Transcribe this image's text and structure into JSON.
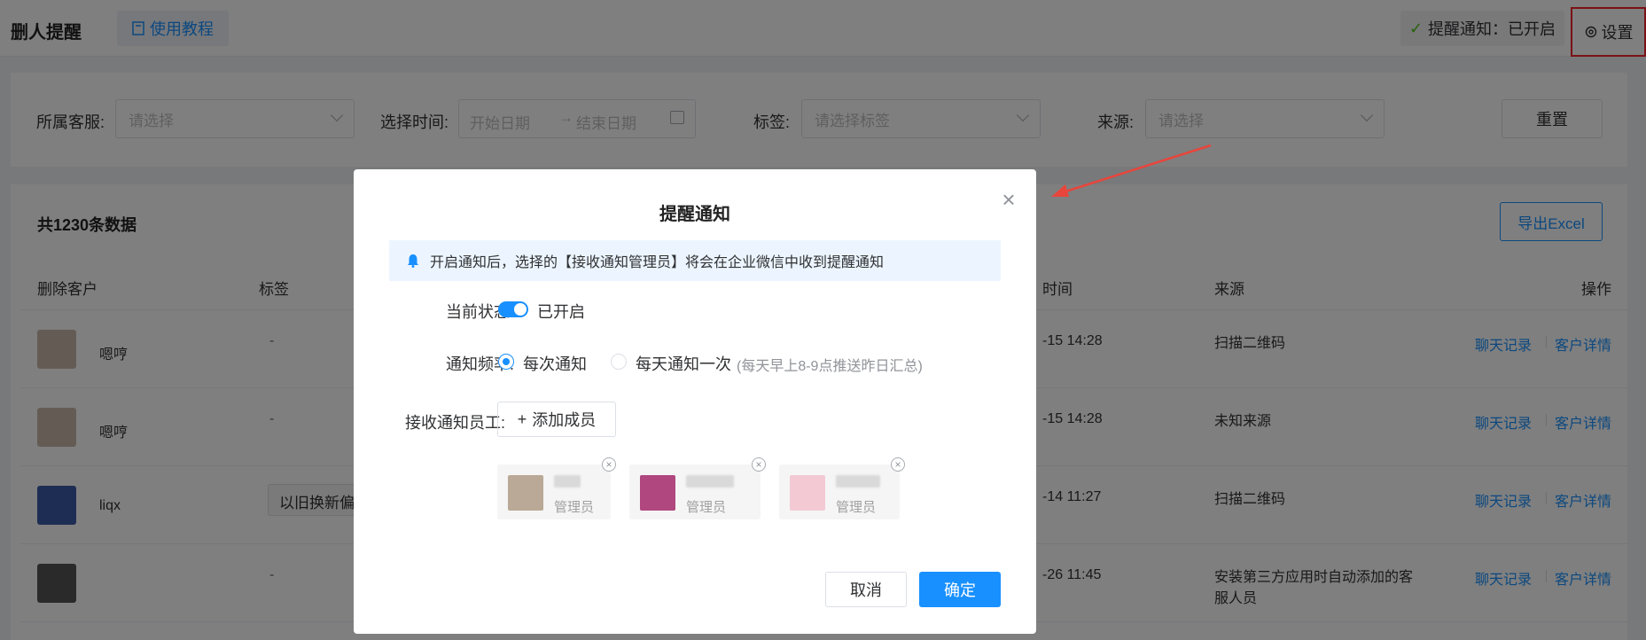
{
  "header": {
    "app_title": "删人提醒",
    "tutorial_label": "使用教程",
    "notice_status_label": "提醒通知：已开启",
    "settings_label": "设置"
  },
  "filters": {
    "cs_label": "所属客服:",
    "cs_placeholder": "请选择",
    "time_label": "选择时间:",
    "start_placeholder": "开始日期",
    "range_arrow": "→",
    "end_placeholder": "结束日期",
    "tag_label": "标签:",
    "tag_placeholder": "请选择标签",
    "source_label": "来源:",
    "source_placeholder": "请选择",
    "reset_label": "重置"
  },
  "table": {
    "total_text": "共1230条数据",
    "export_label": "导出Excel",
    "columns": {
      "customer": "删除客户",
      "tags": "标签",
      "time": "时间",
      "source": "来源",
      "actions": "操作"
    },
    "rows": [
      {
        "name": "嗯哼",
        "tag": "-",
        "time": "-15 14:28",
        "source": "扫描二维码",
        "chat": "聊天记录",
        "detail": "客户详情",
        "avatar_color": "#c9b8a8"
      },
      {
        "name": "嗯哼",
        "tag": "-",
        "time": "-15 14:28",
        "source": "未知来源",
        "chat": "聊天记录",
        "detail": "客户详情",
        "avatar_color": "#c9b8a8"
      },
      {
        "name": "liqx",
        "tag": "以旧换新偏好",
        "time": "-14 11:27",
        "source": "扫描二维码",
        "chat": "聊天记录",
        "detail": "客户详情",
        "avatar_color": "#3d5aa8"
      },
      {
        "name": "",
        "tag": "-",
        "time": "-26 11:45",
        "source": "安装第三方应用时自动添加的客服人员",
        "chat": "聊天记录",
        "detail": "客户详情",
        "avatar_color": "#555555"
      }
    ]
  },
  "modal": {
    "title": "提醒通知",
    "close_glyph": "×",
    "alert_text": "开启通知后，选择的【接收通知管理员】将会在企业微信中收到提醒通知",
    "status_label": "当前状态:",
    "status_value": "已开启",
    "freq_label": "通知频率:",
    "freq_option1": "每次通知",
    "freq_option2": "每天通知一次",
    "freq_option2_hint": "(每天早上8-9点推送昨日汇总)",
    "receiver_label": "接收通知员工:",
    "add_member_icon": "+",
    "add_member_label": "添加成员",
    "members": [
      {
        "role": "管理员",
        "avatar_color": "#b9a996"
      },
      {
        "role": "管理员",
        "avatar_color": "#b0477e"
      },
      {
        "role": "管理员",
        "avatar_color": "#f3c9d4"
      }
    ],
    "member_close_glyph": "×",
    "cancel_label": "取消",
    "ok_label": "确定"
  },
  "colors": {
    "primary": "#1890ff",
    "highlight_box": "#f5222d",
    "arrow": "#e8453c"
  }
}
